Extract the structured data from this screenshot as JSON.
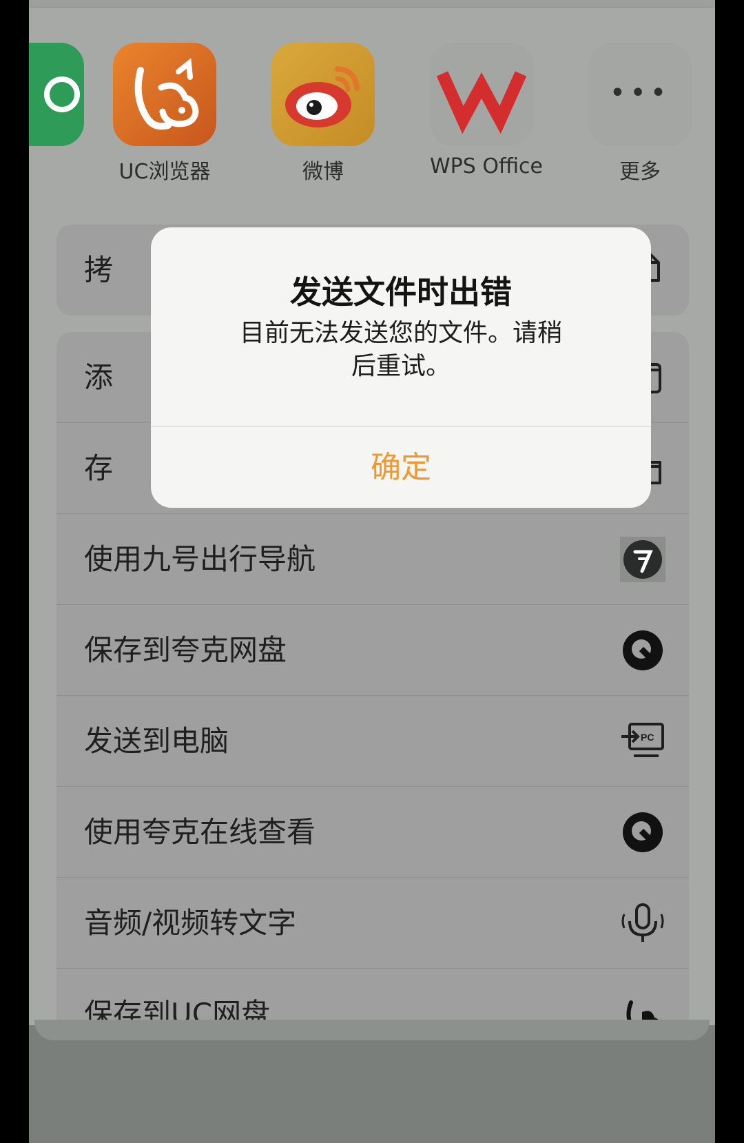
{
  "apps": [
    {
      "label": "",
      "icon": "green-app-icon"
    },
    {
      "label": "UC浏览器",
      "icon": "uc-browser-icon"
    },
    {
      "label": "微博",
      "icon": "weibo-icon"
    },
    {
      "label": "WPS Office",
      "icon": "wps-office-icon"
    },
    {
      "label": "更多",
      "icon": "more-icon"
    }
  ],
  "more_dots": "•••",
  "group1": [
    {
      "label": "拷",
      "icon": "copy-icon"
    }
  ],
  "group2": [
    {
      "label": "添",
      "icon": "markup-icon"
    },
    {
      "label": "存",
      "icon": "folder-icon"
    },
    {
      "label": "使用九号出行导航",
      "icon": "ninebot-icon"
    },
    {
      "label": "保存到夸克网盘",
      "icon": "quark-icon"
    },
    {
      "label": "发送到电脑",
      "icon": "send-to-pc-icon"
    },
    {
      "label": "使用夸克在线查看",
      "icon": "quark-icon"
    },
    {
      "label": "音频/视频转文字",
      "icon": "microphone-icon"
    },
    {
      "label": "保存到UC网盘",
      "icon": "uc-squirrel-icon"
    }
  ],
  "dialog": {
    "title": "发送文件时出错",
    "message": "目前无法发送您的文件。请稍后重试。",
    "ok": "确定"
  },
  "colors": {
    "accent": "#ec9a2f",
    "dialog_bg": "#f5f5f4",
    "dim_bg": "#a7a9a7"
  }
}
